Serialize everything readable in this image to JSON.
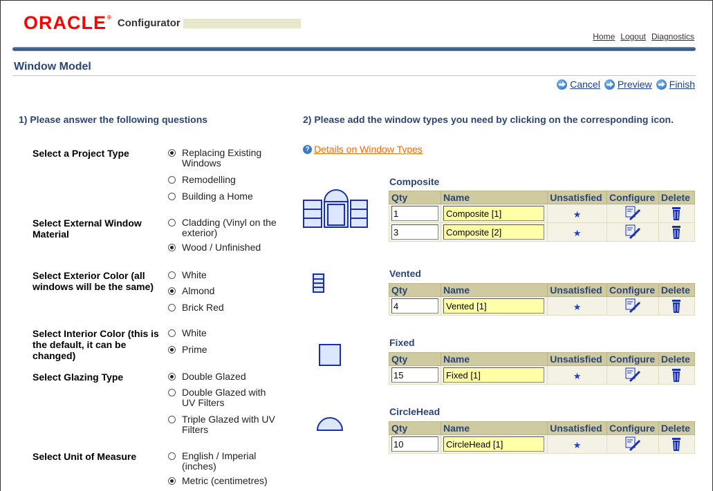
{
  "header": {
    "logo": "ORACLE",
    "logo_tm": "®",
    "product": "Configurator",
    "links": [
      "Home",
      "Logout",
      "Diagnostics"
    ]
  },
  "page": {
    "title": "Window Model",
    "actions": [
      "Cancel",
      "Preview",
      "Finish"
    ]
  },
  "questions": {
    "heading": "1) Please answer the following questions",
    "items": [
      {
        "label": "Select a Project Type",
        "options": [
          {
            "text": "Replacing Existing Windows",
            "checked": true
          },
          {
            "text": "Remodelling",
            "checked": false
          },
          {
            "text": "Building a Home",
            "checked": false
          }
        ]
      },
      {
        "label": "Select External Window Material",
        "options": [
          {
            "text": "Cladding (Vinyl on the exterior)",
            "checked": false
          },
          {
            "text": "Wood / Unfinished",
            "checked": true
          }
        ]
      },
      {
        "label": "Select Exterior Color (all windows will be the same)",
        "options": [
          {
            "text": "White",
            "checked": false
          },
          {
            "text": "Almond",
            "checked": true
          },
          {
            "text": "Brick Red",
            "checked": false
          }
        ]
      },
      {
        "label": "Select Interior Color (this is the default, it can be changed)",
        "options": [
          {
            "text": "White",
            "checked": false
          },
          {
            "text": "Prime",
            "checked": true
          }
        ]
      },
      {
        "label": "Select Glazing Type",
        "options": [
          {
            "text": "Double Glazed",
            "checked": true
          },
          {
            "text": "Double Glazed with UV Filters",
            "checked": false
          },
          {
            "text": "Triple Glazed with UV Filters",
            "checked": false
          }
        ]
      },
      {
        "label": "Select Unit of Measure",
        "options": [
          {
            "text": "English / Imperial (inches)",
            "checked": false
          },
          {
            "text": "Metric (centimetres)",
            "checked": true
          }
        ]
      }
    ]
  },
  "window_types": {
    "heading": "2) Please add the window types you need by clicking on the corresponding icon.",
    "help_icon": "?",
    "help_link": "Details on Window Types",
    "columns": [
      "Qty",
      "Name",
      "Unsatisfied",
      "Configure",
      "Delete"
    ],
    "unsatisfied_mark": "★",
    "groups": [
      {
        "title": "Composite",
        "icon": "composite-window-icon",
        "rows": [
          {
            "qty": "1",
            "name": "Composite [1]"
          },
          {
            "qty": "3",
            "name": "Composite [2]"
          }
        ]
      },
      {
        "title": "Vented",
        "icon": "vented-window-icon",
        "rows": [
          {
            "qty": "4",
            "name": "Vented [1]"
          }
        ]
      },
      {
        "title": "Fixed",
        "icon": "fixed-window-icon",
        "rows": [
          {
            "qty": "15",
            "name": "Fixed [1]"
          }
        ]
      },
      {
        "title": "CircleHead",
        "icon": "circlehead-window-icon",
        "rows": [
          {
            "qty": "10",
            "name": "CircleHead [1]"
          }
        ]
      }
    ]
  },
  "colors": {
    "brand_red": "#ff0000",
    "heading_blue": "#2b4575",
    "table_header": "#cfcaa0",
    "name_field": "#ffffa8",
    "link_orange": "#ff6a00"
  }
}
